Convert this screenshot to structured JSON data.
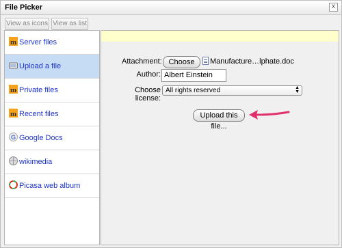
{
  "window": {
    "title": "File Picker",
    "close_glyph": "x"
  },
  "toolbar": {
    "view_icons_label": "View as icons",
    "view_list_label": "View as list"
  },
  "sidebar": {
    "items": [
      {
        "label": "Server files",
        "icon": "moodle-icon"
      },
      {
        "label": "Upload a file",
        "icon": "upload-icon",
        "active": true
      },
      {
        "label": "Private files",
        "icon": "moodle-icon"
      },
      {
        "label": "Recent files",
        "icon": "moodle-icon"
      },
      {
        "label": "Google Docs",
        "icon": "google-icon"
      },
      {
        "label": "wikimedia",
        "icon": "wikimedia-icon"
      },
      {
        "label": "Picasa web album",
        "icon": "picasa-icon"
      }
    ]
  },
  "form": {
    "attachment_label": "Attachment:",
    "choose_file_label": "Choose File",
    "file_name": "Manufacture…lphate.doc",
    "author_label": "Author:",
    "author_value": "Albert Einstein",
    "license_label": "Choose license:",
    "license_value": "All rights reserved",
    "upload_button": "Upload this file..."
  },
  "colors": {
    "accent_arrow": "#e0306a",
    "link": "#1b33c9",
    "selected": "#c6dcf5",
    "banner": "#ffffcc"
  }
}
